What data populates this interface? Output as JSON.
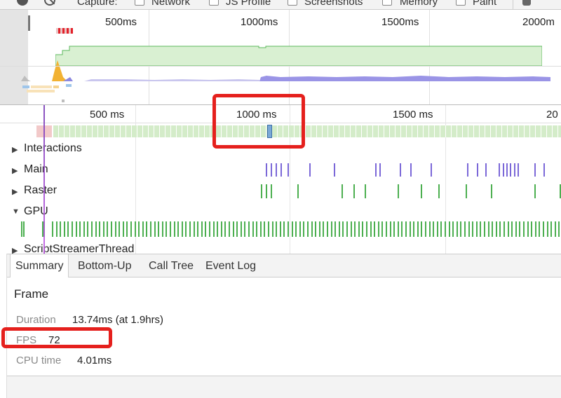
{
  "toolbar": {
    "capture_label": "Capture:",
    "options": [
      "Network",
      "JS Profile",
      "Screenshots",
      "Memory",
      "Paint"
    ]
  },
  "overview": {
    "ticks": [
      "500ms",
      "1000ms",
      "1500ms",
      "2000m"
    ]
  },
  "ruler": {
    "ticks": [
      "500 ms",
      "1000 ms",
      "1500 ms",
      "20"
    ]
  },
  "tracks": [
    {
      "label": "Interactions",
      "expanded": false
    },
    {
      "label": "Main",
      "expanded": false
    },
    {
      "label": "Raster",
      "expanded": false
    },
    {
      "label": "GPU",
      "expanded": true
    },
    {
      "label": "ScriptStreamerThread",
      "expanded": false
    }
  ],
  "tabs": [
    "Summary",
    "Bottom-Up",
    "Call Tree",
    "Event Log"
  ],
  "active_tab": "Summary",
  "summary": {
    "title": "Frame",
    "duration_label": "Duration",
    "duration_value": "13.74ms (at 1.9hrs)",
    "fps_label": "FPS",
    "fps_value": "72",
    "cpu_label": "CPU time",
    "cpu_value": "4.01ms"
  },
  "colors": {
    "highlight": "#e5201d",
    "frame_green": "#d4ecc9",
    "main_task": "#7b68d8",
    "raster_task": "#4caf50",
    "selected_frame": "#7aa8d6"
  }
}
